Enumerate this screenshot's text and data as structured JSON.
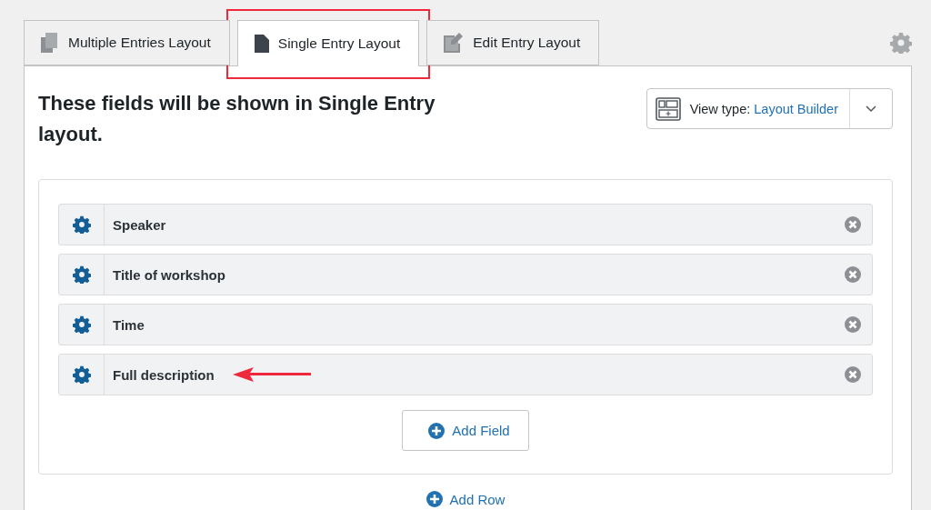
{
  "tabs": [
    {
      "label": "Multiple Entries Layout",
      "kind": "copy",
      "selected": false,
      "outlined": false
    },
    {
      "label": "Single Entry Layout",
      "kind": "page",
      "selected": true,
      "outlined": true
    },
    {
      "label": "Edit Entry Layout",
      "kind": "edit",
      "selected": false,
      "outlined": false
    }
  ],
  "heading": "These fields will be shown in Single Entry layout.",
  "view_type": {
    "label": "View type:",
    "value": "Layout Builder"
  },
  "fields": [
    {
      "label": "Speaker",
      "arrow": false
    },
    {
      "label": "Title of workshop",
      "arrow": false
    },
    {
      "label": "Time",
      "arrow": false
    },
    {
      "label": "Full description",
      "arrow": true
    }
  ],
  "add_field": "Add Field",
  "add_row": "Add Row"
}
